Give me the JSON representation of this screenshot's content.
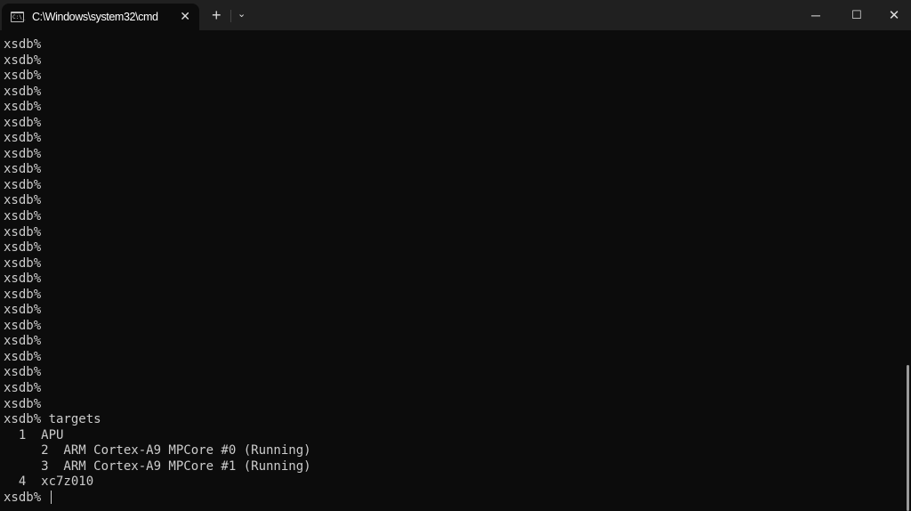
{
  "window": {
    "tab_title": "C:\\Windows\\system32\\cmd",
    "tab_icon": "cmd-icon",
    "tab_icon_text": "C:\\_"
  },
  "controls": {
    "new_tab": "+",
    "dropdown": "⌄",
    "minimize": "─",
    "maximize": "☐",
    "close": "✕"
  },
  "terminal": {
    "lines": [
      "xsdb%",
      "xsdb%",
      "xsdb%",
      "xsdb%",
      "xsdb%",
      "xsdb%",
      "xsdb%",
      "xsdb%",
      "xsdb%",
      "xsdb%",
      "xsdb%",
      "xsdb%",
      "xsdb%",
      "xsdb%",
      "xsdb%",
      "xsdb%",
      "xsdb%",
      "xsdb%",
      "xsdb%",
      "xsdb%",
      "xsdb%",
      "xsdb%",
      "xsdb%",
      "xsdb%",
      "xsdb% targets",
      "  1  APU",
      "     2  ARM Cortex-A9 MPCore #0 (Running)",
      "     3  ARM Cortex-A9 MPCore #1 (Running)",
      "  4  xc7z010"
    ],
    "prompt": "xsdb% "
  }
}
